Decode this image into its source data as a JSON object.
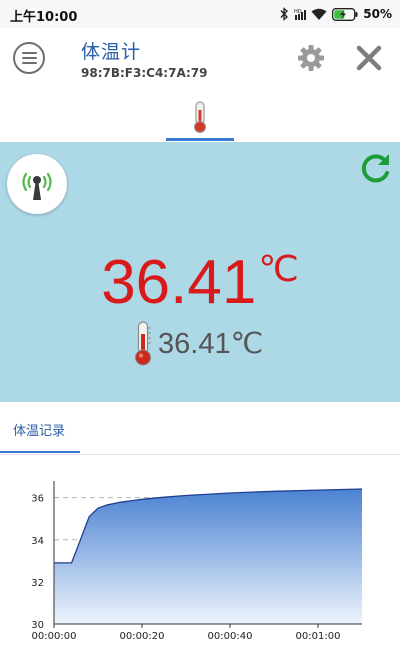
{
  "status_bar": {
    "time": "上午10:00",
    "battery": "50%",
    "icons": [
      "bluetooth-icon",
      "hd-icon",
      "wifi-icon",
      "battery-charging-icon"
    ]
  },
  "app_bar": {
    "title": "体温计",
    "device_address": "98:7B:F3:C4:7A:79",
    "icons": [
      "menu-icon",
      "gear-icon",
      "close-icon"
    ]
  },
  "tabs": [
    {
      "icon": "thermometer-icon",
      "selected": true
    }
  ],
  "reading": {
    "main_value": "36.41",
    "main_unit": "℃",
    "secondary": "36.41℃",
    "color": "#d81a1a",
    "icons": [
      "signal-antenna-icon",
      "refresh-icon",
      "thermometer-icon"
    ]
  },
  "record": {
    "title": "体温记录"
  },
  "colors": {
    "accent": "#2a5ea7",
    "panel_bg": "#add8e6",
    "reading": "#d81a1a",
    "refresh": "#1e9e3a"
  },
  "chart_data": {
    "type": "area",
    "title": "",
    "xlabel": "",
    "ylabel": "",
    "x_tick_labels": [
      "00:00:00",
      "00:00:20",
      "00:00:40",
      "00:01:00"
    ],
    "x_ticks_seconds": [
      0,
      20,
      40,
      60
    ],
    "xlim": [
      0,
      70
    ],
    "y_tick_labels": [
      "30",
      "32",
      "34",
      "36"
    ],
    "ylim": [
      30,
      36.6
    ],
    "grid": "horizontal-dashed",
    "series": [
      {
        "x": [
          0,
          4,
          6,
          8,
          10,
          12,
          15,
          20,
          25,
          30,
          40,
          50,
          60,
          70
        ],
        "y": [
          32.9,
          32.9,
          34.0,
          35.1,
          35.5,
          35.65,
          35.78,
          35.92,
          36.02,
          36.1,
          36.22,
          36.3,
          36.36,
          36.41
        ]
      }
    ]
  }
}
